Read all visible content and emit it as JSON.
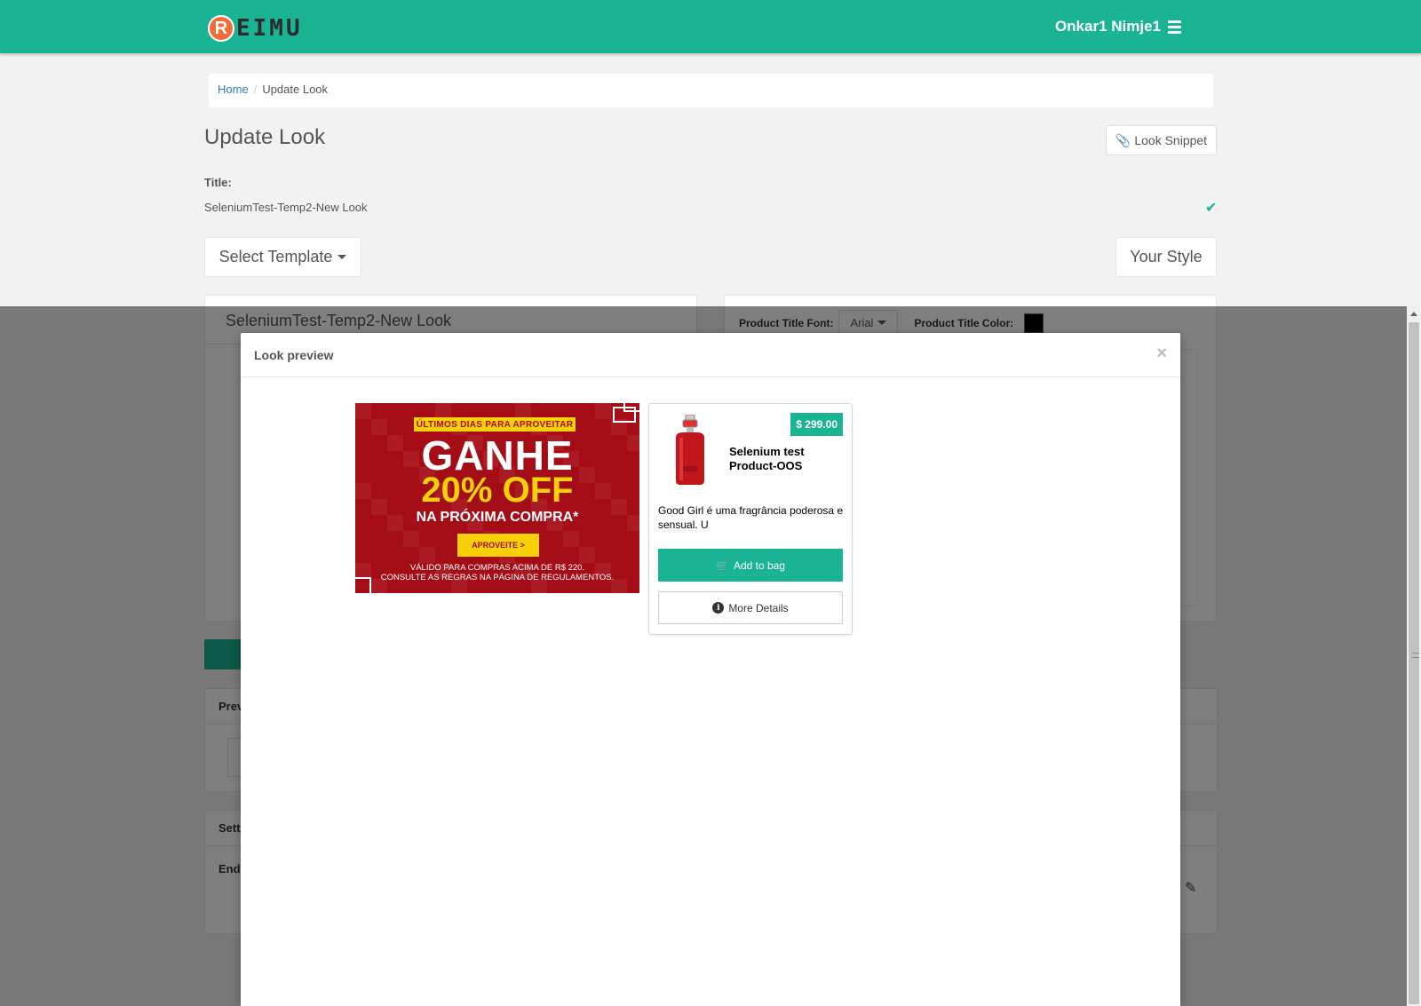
{
  "navbar": {
    "logo_letter": "R",
    "logo_text": "EIMU",
    "user_name": "Onkar1 Nimje1",
    "brand_color": "#1ab394",
    "menu_icon": "hamburger-icon"
  },
  "breadcrumb": {
    "home": "Home",
    "separator": "/",
    "current": "Update Look"
  },
  "page": {
    "title": "Update Look",
    "snippet_button": "Look Snippet",
    "title_label": "Title:",
    "title_value": "SeleniumTest-Temp2-New Look",
    "select_template": "Select Template",
    "your_style": "Your Style"
  },
  "left_panel": {
    "heading": "SeleniumTest-Temp2-New Look"
  },
  "right_panel": {
    "font_label": "Product Title Font:",
    "font_value": "Arial",
    "color_label": "Product Title Color:",
    "color_value": "#000000"
  },
  "preview_panel": {
    "heading": "Prev"
  },
  "settings_panel": {
    "heading": "Sett",
    "endpoint_label": "Endp"
  },
  "modal": {
    "title": "Look preview",
    "close": "×"
  },
  "banner": {
    "tag": "ÚLTIMOS DIAS PARA APROVEITAR",
    "headline": "GANHE",
    "offer": "20% OFF",
    "subline": "NA PRÓXIMA COMPRA*",
    "cta": "APROVEITE >",
    "fine_line1": "VÁLIDO PARA COMPRAS ACIMA DE R$ 220.",
    "fine_line2": "CONSULTE AS REGRAS NA PÁGINA DE REGULAMENTOS."
  },
  "product": {
    "price": "$ 299.00",
    "name": "Selenium test Product-OOS",
    "description": "Good Girl é uma fragrância poderosa e sensual. U",
    "add_to_bag": "Add to bag",
    "more_details": "More Details"
  }
}
